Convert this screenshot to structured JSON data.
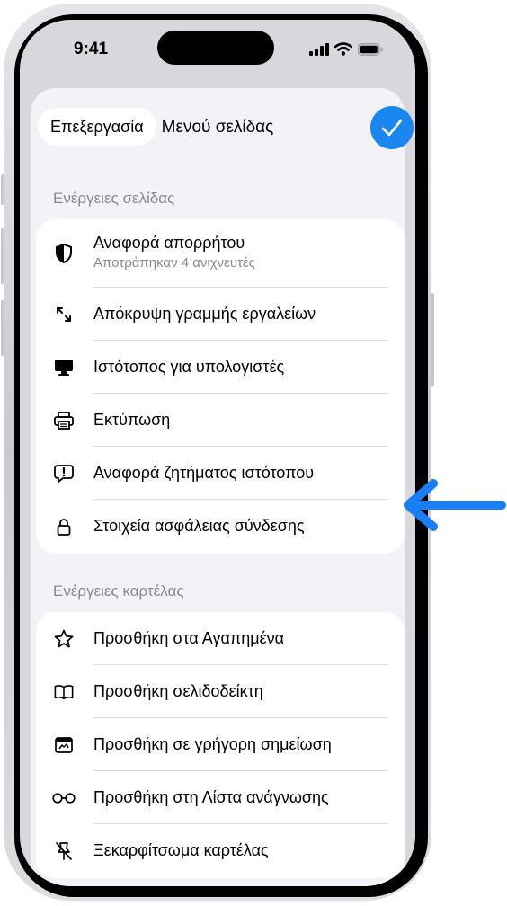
{
  "status_bar": {
    "time": "9:41"
  },
  "sheet": {
    "edit_label": "Επεξεργασία",
    "title": "Μενού σελίδας"
  },
  "page_actions": {
    "header": "Ενέργειες σελίδας",
    "items": [
      {
        "label": "Αναφορά απορρήτου",
        "sublabel": "Αποτράπηκαν 4 ανιχνευτές",
        "icon": "privacy-shield-icon"
      },
      {
        "label": "Απόκρυψη γραμμής εργαλείων",
        "icon": "expand-arrows-icon"
      },
      {
        "label": "Ιστότοπος για υπολογιστές",
        "icon": "desktop-monitor-icon"
      },
      {
        "label": "Εκτύπωση",
        "icon": "printer-icon"
      },
      {
        "label": "Αναφορά ζητήματος ιστότοπου",
        "icon": "report-bubble-icon"
      },
      {
        "label": "Στοιχεία ασφάλειας σύνδεσης",
        "icon": "lock-icon"
      }
    ]
  },
  "tab_actions": {
    "header": "Ενέργειες καρτέλας",
    "items": [
      {
        "label": "Προσθήκη στα Αγαπημένα",
        "icon": "star-icon"
      },
      {
        "label": "Προσθήκη σελιδοδείκτη",
        "icon": "book-icon"
      },
      {
        "label": "Προσθήκη σε γρήγορη σημείωση",
        "icon": "quick-note-icon"
      },
      {
        "label": "Προσθήκη στη Λίστα ανάγνωσης",
        "icon": "glasses-icon"
      },
      {
        "label": "Ξεκαρφίτσωμα καρτέλας",
        "icon": "unpin-icon"
      }
    ]
  },
  "colors": {
    "accent": "#1a86f0",
    "callout": "#1a7ef5",
    "sheet_bg": "#f2f2f7",
    "secondary_text": "#8a8a8e"
  }
}
